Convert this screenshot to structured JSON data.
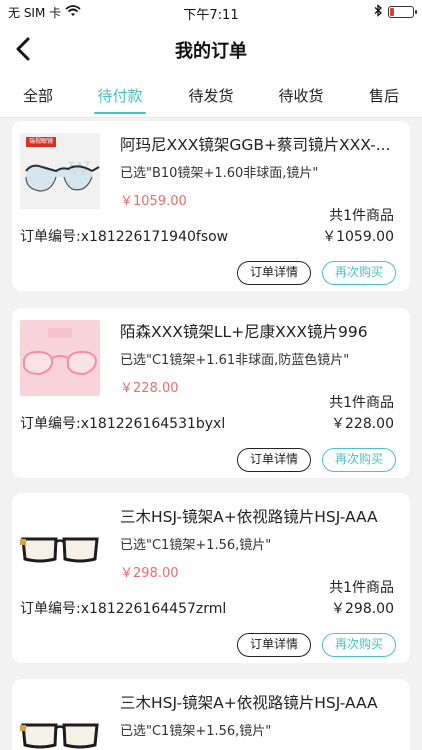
{
  "status_bar": {
    "carrier": "无 SIM 卡",
    "time": "下午7:11"
  },
  "nav": {
    "title": "我的订单"
  },
  "tabs": [
    {
      "label": "全部",
      "active": false
    },
    {
      "label": "待付款",
      "active": true
    },
    {
      "label": "待发货",
      "active": false
    },
    {
      "label": "待收货",
      "active": false
    },
    {
      "label": "售后",
      "active": false
    }
  ],
  "orders": [
    {
      "name": "阿玛尼XXX镜架GGB+蔡司镜片XXX-...",
      "spec": "已选\"B10镜架+1.60非球面,镜片\"",
      "price": "￥1059.00",
      "qty": "共1件商品",
      "order_no": "订单编号:x181226171940fsow",
      "total": "￥1059.00",
      "detail_label": "订单详情",
      "rebuy_label": "再次购买",
      "thumb_badge": "瑞视眼镜"
    },
    {
      "name": "陌森XXX镜架LL+尼康XXX镜片996",
      "spec": "已选\"C1镜架+1.61非球面,防蓝色镜片\"",
      "price": "￥228.00",
      "qty": "共1件商品",
      "order_no": "订单编号:x181226164531byxl",
      "total": "￥228.00",
      "detail_label": "订单详情",
      "rebuy_label": "再次购买"
    },
    {
      "name": "三木HSJ-镜架A+依视路镜片HSJ-AAA",
      "spec": "已选\"C1镜架+1.56,镜片\"",
      "price": "￥298.00",
      "qty": "共1件商品",
      "order_no": "订单编号:x181226164457zrml",
      "total": "￥298.00",
      "detail_label": "订单详情",
      "rebuy_label": "再次购买"
    },
    {
      "name": "三木HSJ-镜架A+依视路镜片HSJ-AAA",
      "spec": "已选\"C1镜架+1.56,镜片\""
    }
  ],
  "colors": {
    "accent": "#4cc1c1",
    "price": "#f06a6a",
    "battery_low": "#e53935"
  },
  "icons": [
    "wifi-icon",
    "back-arrow-icon",
    "bluetooth-icon",
    "battery-icon"
  ]
}
